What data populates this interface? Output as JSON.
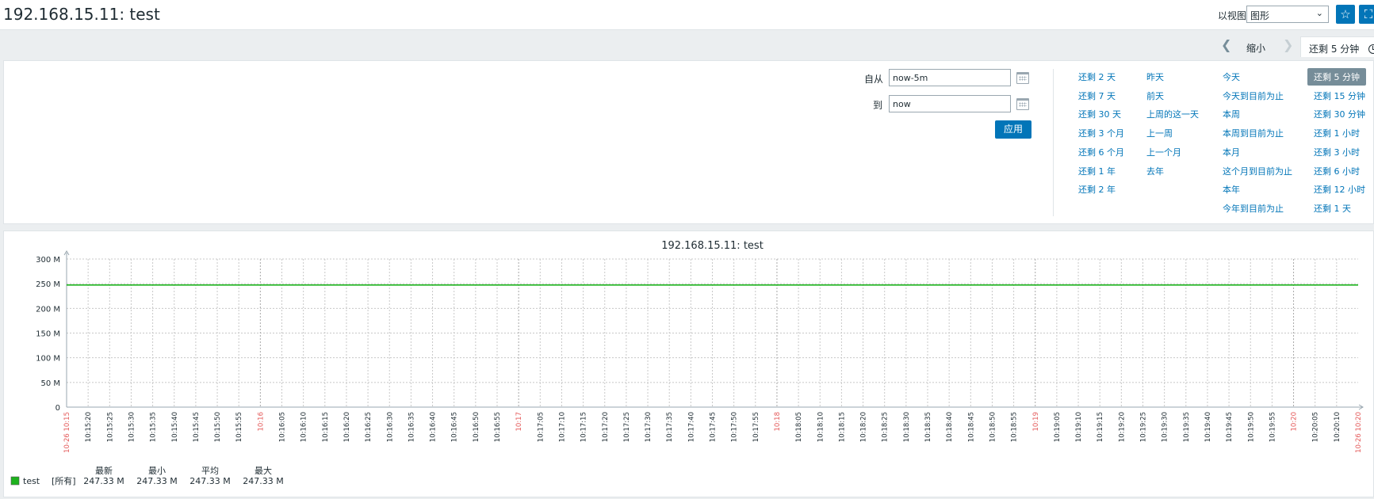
{
  "header": {
    "title": "192.168.15.11: test",
    "view_label": "以视图",
    "view_select": "图形",
    "favorite_icon": "star-icon",
    "fullscreen_icon": "fullscreen-icon"
  },
  "time_nav": {
    "zoom_out": "缩小",
    "current_range": "还剩 5 分钟"
  },
  "filter": {
    "from_label": "自从",
    "from_value": "now-5m",
    "to_label": "到",
    "to_value": "now",
    "apply": "应用",
    "quick_ranges": [
      [
        "还剩 2 天",
        "还剩 7 天",
        "还剩 30 天",
        "还剩 3 个月",
        "还剩 6 个月",
        "还剩 1 年",
        "还剩 2 年"
      ],
      [
        "昨天",
        "前天",
        "上周的这一天",
        "上一周",
        "上一个月",
        "去年"
      ],
      [
        "今天",
        "今天到目前为止",
        "本周",
        "本周到目前为止",
        "本月",
        "这个月到目前为止",
        "本年",
        "今年到目前为止"
      ],
      [
        "还剩 5 分钟",
        "还剩 15 分钟",
        "还剩 30 分钟",
        "还剩 1 小时",
        "还剩 3 小时",
        "还剩 6 小时",
        "还剩 12 小时",
        "还剩 1 天"
      ]
    ],
    "active_range": "还剩 5 分钟"
  },
  "chart_data": {
    "type": "line",
    "title": "192.168.15.11: test",
    "y_ticks": [
      "0",
      "50 M",
      "100 M",
      "150 M",
      "200 M",
      "250 M",
      "300 M"
    ],
    "ylim": [
      0,
      300
    ],
    "y_unit": "M",
    "x_start_label": "10-26 10:15",
    "x_end_label": "10-26 10:20",
    "x_ticks": [
      "10:15:20",
      "10:15:25",
      "10:15:30",
      "10:15:35",
      "10:15:40",
      "10:15:45",
      "10:15:50",
      "10:15:55",
      "10:16",
      "10:16:05",
      "10:16:10",
      "10:16:15",
      "10:16:20",
      "10:16:25",
      "10:16:30",
      "10:16:35",
      "10:16:40",
      "10:16:45",
      "10:16:50",
      "10:16:55",
      "10:17",
      "10:17:05",
      "10:17:10",
      "10:17:15",
      "10:17:20",
      "10:17:25",
      "10:17:30",
      "10:17:35",
      "10:17:40",
      "10:17:45",
      "10:17:50",
      "10:17:55",
      "10:18",
      "10:18:05",
      "10:18:10",
      "10:18:15",
      "10:18:20",
      "10:18:25",
      "10:18:30",
      "10:18:35",
      "10:18:40",
      "10:18:45",
      "10:18:50",
      "10:18:55",
      "10:19",
      "10:19:05",
      "10:19:10",
      "10:19:15",
      "10:19:20",
      "10:19:25",
      "10:19:30",
      "10:19:35",
      "10:19:40",
      "10:19:45",
      "10:19:50",
      "10:19:55",
      "10:20",
      "10:20:05",
      "10:20:10"
    ],
    "series": [
      {
        "name": "test",
        "color": "#1db21d",
        "values": [
          247.33,
          247.33
        ]
      }
    ],
    "grid": true,
    "legend": {
      "headers": [
        "最新",
        "最小",
        "平均",
        "最大"
      ],
      "rows": [
        {
          "name": "test",
          "func": "[所有]",
          "last": "247.33 M",
          "min": "247.33 M",
          "avg": "247.33 M",
          "max": "247.33 M",
          "color": "#1db21d"
        }
      ]
    }
  }
}
